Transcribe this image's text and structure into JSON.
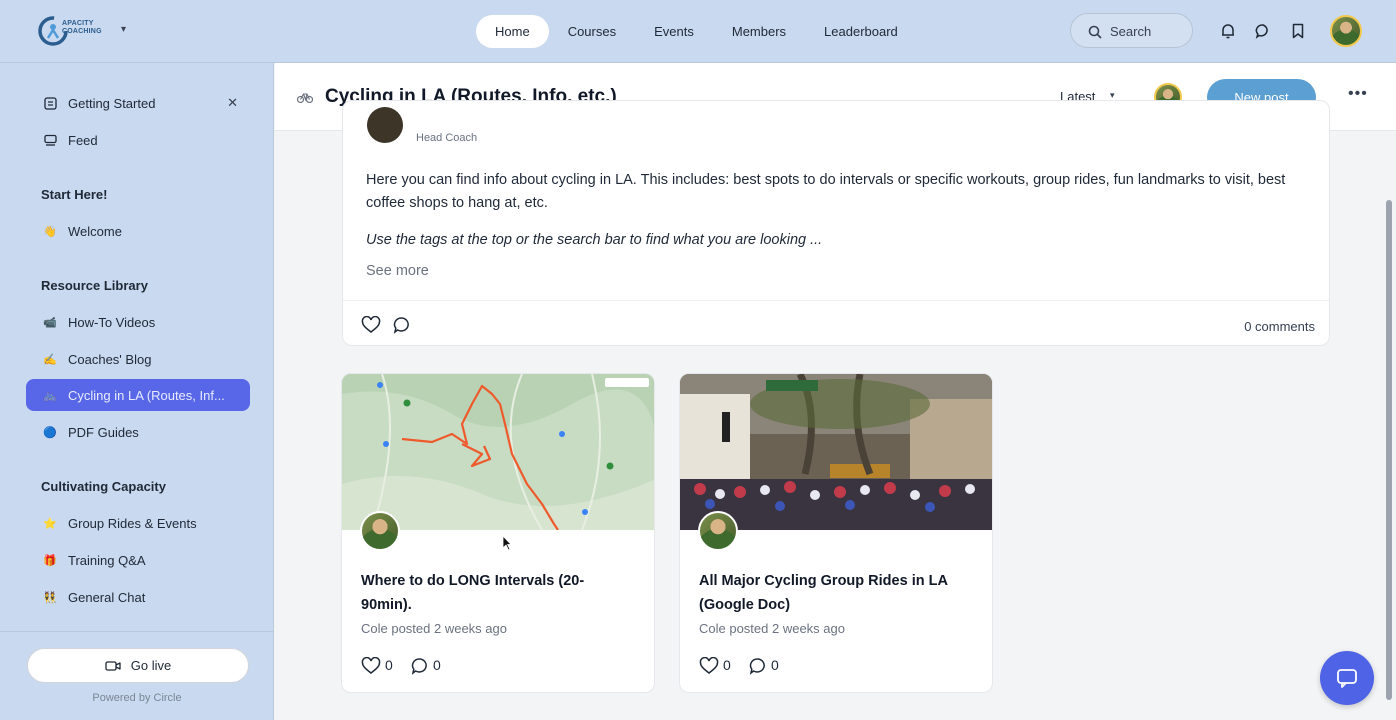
{
  "brand": {
    "logo_text_line1": "APACITY",
    "logo_text_line2": "COACHING"
  },
  "nav": {
    "items": [
      "Home",
      "Courses",
      "Events",
      "Members",
      "Leaderboard"
    ],
    "active": "Home",
    "search_label": "Search"
  },
  "sidebar": {
    "getting_started": "Getting Started",
    "feed": "Feed",
    "sections": [
      {
        "heading": "Start Here!",
        "items": [
          {
            "label": "Welcome",
            "emoji": "👋"
          }
        ]
      },
      {
        "heading": "Resource Library",
        "items": [
          {
            "label": "How-To Videos",
            "emoji": "📹"
          },
          {
            "label": "Coaches' Blog",
            "emoji": "✍️"
          },
          {
            "label": "Cycling in LA (Routes, Inf...",
            "emoji": "🚲",
            "active": true
          },
          {
            "label": "PDF Guides",
            "emoji": "🔵"
          }
        ]
      },
      {
        "heading": "Cultivating Capacity",
        "items": [
          {
            "label": "Group Rides & Events",
            "emoji": "⭐"
          },
          {
            "label": "Training Q&A",
            "emoji": "🎁"
          },
          {
            "label": "General Chat",
            "emoji": "👯"
          }
        ]
      }
    ],
    "go_live": "Go live",
    "powered_by": "Powered by Circle"
  },
  "space": {
    "title": "Cycling in LA (Routes, Info, etc.)",
    "sort": "Latest",
    "new_post": "New post"
  },
  "pinned_post": {
    "role": "Head Coach",
    "body": "Here you can find info about cycling in LA. This includes: best spots to do intervals or specific workouts, group rides, fun landmarks to visit, best coffee shops to hang at, etc.",
    "italic": "Use the tags at the top or the search bar to find what you are looking ...",
    "see_more": "See more",
    "comments": "0 comments"
  },
  "posts": [
    {
      "title": "Where to do LONG Intervals (20-90min).",
      "meta": "Cole posted 2 weeks ago",
      "likes": "0",
      "comments": "0"
    },
    {
      "title": "All Major Cycling Group Rides in LA (Google Doc)",
      "meta": "Cole posted 2 weeks ago",
      "likes": "0",
      "comments": "0"
    }
  ],
  "colors": {
    "accent": "#5867e8",
    "primary_button": "#5c9fd3",
    "sidebar_bg": "#c9d9ef",
    "chat_fab": "#4f63e6"
  }
}
